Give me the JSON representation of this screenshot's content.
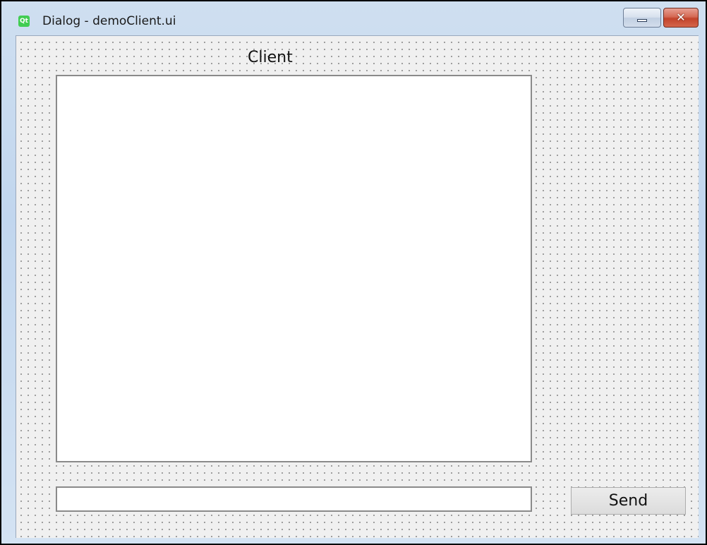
{
  "window": {
    "title": "Dialog - demoClient.ui",
    "app_icon": "qt-logo-icon",
    "minimize_glyph": "minimize-icon",
    "close_glyph": "✕"
  },
  "dialog": {
    "heading": "Client",
    "message_area_text": "",
    "input": {
      "value": "",
      "placeholder": ""
    },
    "send_label": "Send"
  },
  "colors": {
    "frame_border": "#000000",
    "title_bar": "#c1d6ee",
    "form_background": "#f0f0f0",
    "grid_dot": "#8a8a8a",
    "close_button": "#c2432b",
    "qt_brand": "#41cd52"
  }
}
